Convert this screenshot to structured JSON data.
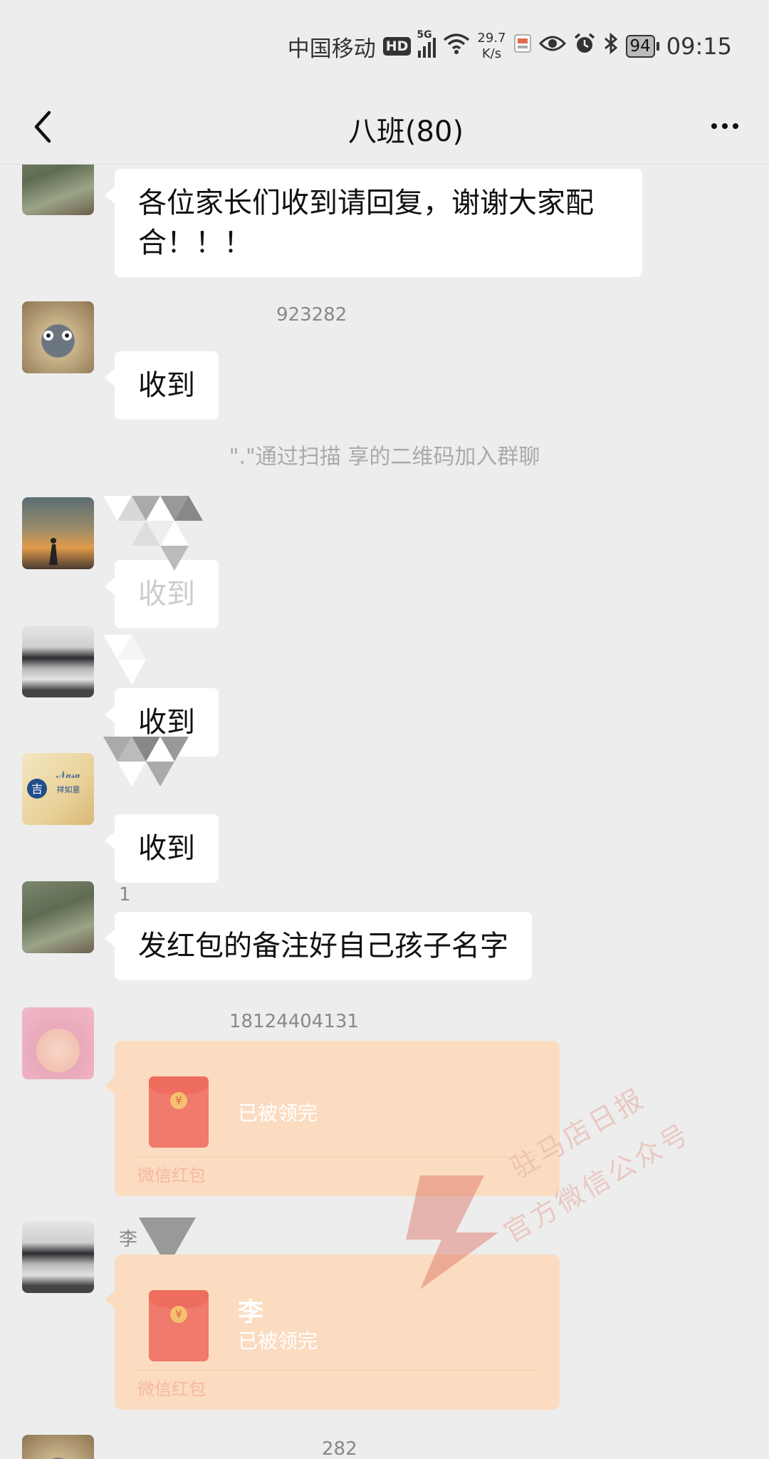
{
  "status_bar": {
    "carrier": "中国移动",
    "hd": "HD",
    "net_type": "5G",
    "speed_value": "29.7",
    "speed_unit": "K/s",
    "battery": "94",
    "time": "09:15"
  },
  "nav": {
    "title": "八班(80)"
  },
  "messages": [
    {
      "type": "text",
      "text": "各位家长们收到请回复，谢谢大家配合！！！"
    },
    {
      "type": "text",
      "sender": "923282",
      "text": "收到"
    },
    {
      "type": "system",
      "text": "\".\"通过扫描  享的二维码加入群聊"
    },
    {
      "type": "text",
      "text": "收到"
    },
    {
      "type": "text",
      "text": "收到"
    },
    {
      "type": "text",
      "text": "收到"
    },
    {
      "type": "text",
      "sender": "1",
      "text": "发红包的备注好自己孩子名字"
    },
    {
      "type": "redpacket",
      "sender": "18124404131",
      "status": "已被领完",
      "footer": "微信红包"
    },
    {
      "type": "redpacket",
      "sender": "李",
      "name": "李",
      "status": "已被领完",
      "footer": "微信红包"
    },
    {
      "type": "text",
      "sender": "282"
    }
  ],
  "watermark": {
    "line1": "驻马店日报",
    "line2": "官方微信公众号"
  }
}
